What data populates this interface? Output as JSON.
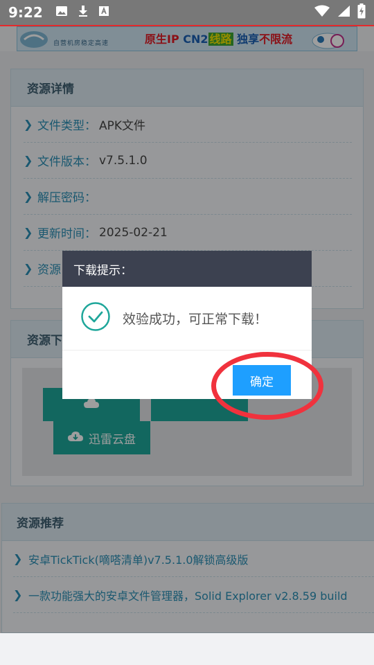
{
  "status_bar": {
    "time": "9:22"
  },
  "banner": {
    "line1": "自营机房稳定高速",
    "seg1": "原生IP",
    "seg2": "CN2",
    "seg3": "线路",
    "seg4": "独享",
    "seg5": "不限流"
  },
  "details": {
    "title": "资源详情",
    "rows": [
      {
        "label": "文件类型",
        "value": "APK文件"
      },
      {
        "label": "文件版本",
        "value": "v7.5.1.0"
      },
      {
        "label": "解压密码",
        "value": ""
      },
      {
        "label": "更新时间",
        "value": "2025-02-21"
      },
      {
        "label": "资源",
        "value": ""
      }
    ],
    "separator": "："
  },
  "download": {
    "title": "资源下",
    "buttons": {
      "xunlei": "迅雷云盘"
    }
  },
  "recommend": {
    "title": "资源推荐",
    "items": [
      "安卓TickTick(嘀嗒清单)v7.5.1.0解锁高级版",
      "一款功能强大的安卓文件管理器，Solid Explorer v2.8.59 build"
    ]
  },
  "dialog": {
    "title": "下载提示：",
    "message": "效验成功，可正常下载！",
    "confirm": "确定"
  },
  "colors": {
    "accent": "#1e9fff",
    "teal": "#1ea69a",
    "link": "#2b8fb5",
    "dialog_head": "#3c4150",
    "highlight": "#f0323d"
  }
}
